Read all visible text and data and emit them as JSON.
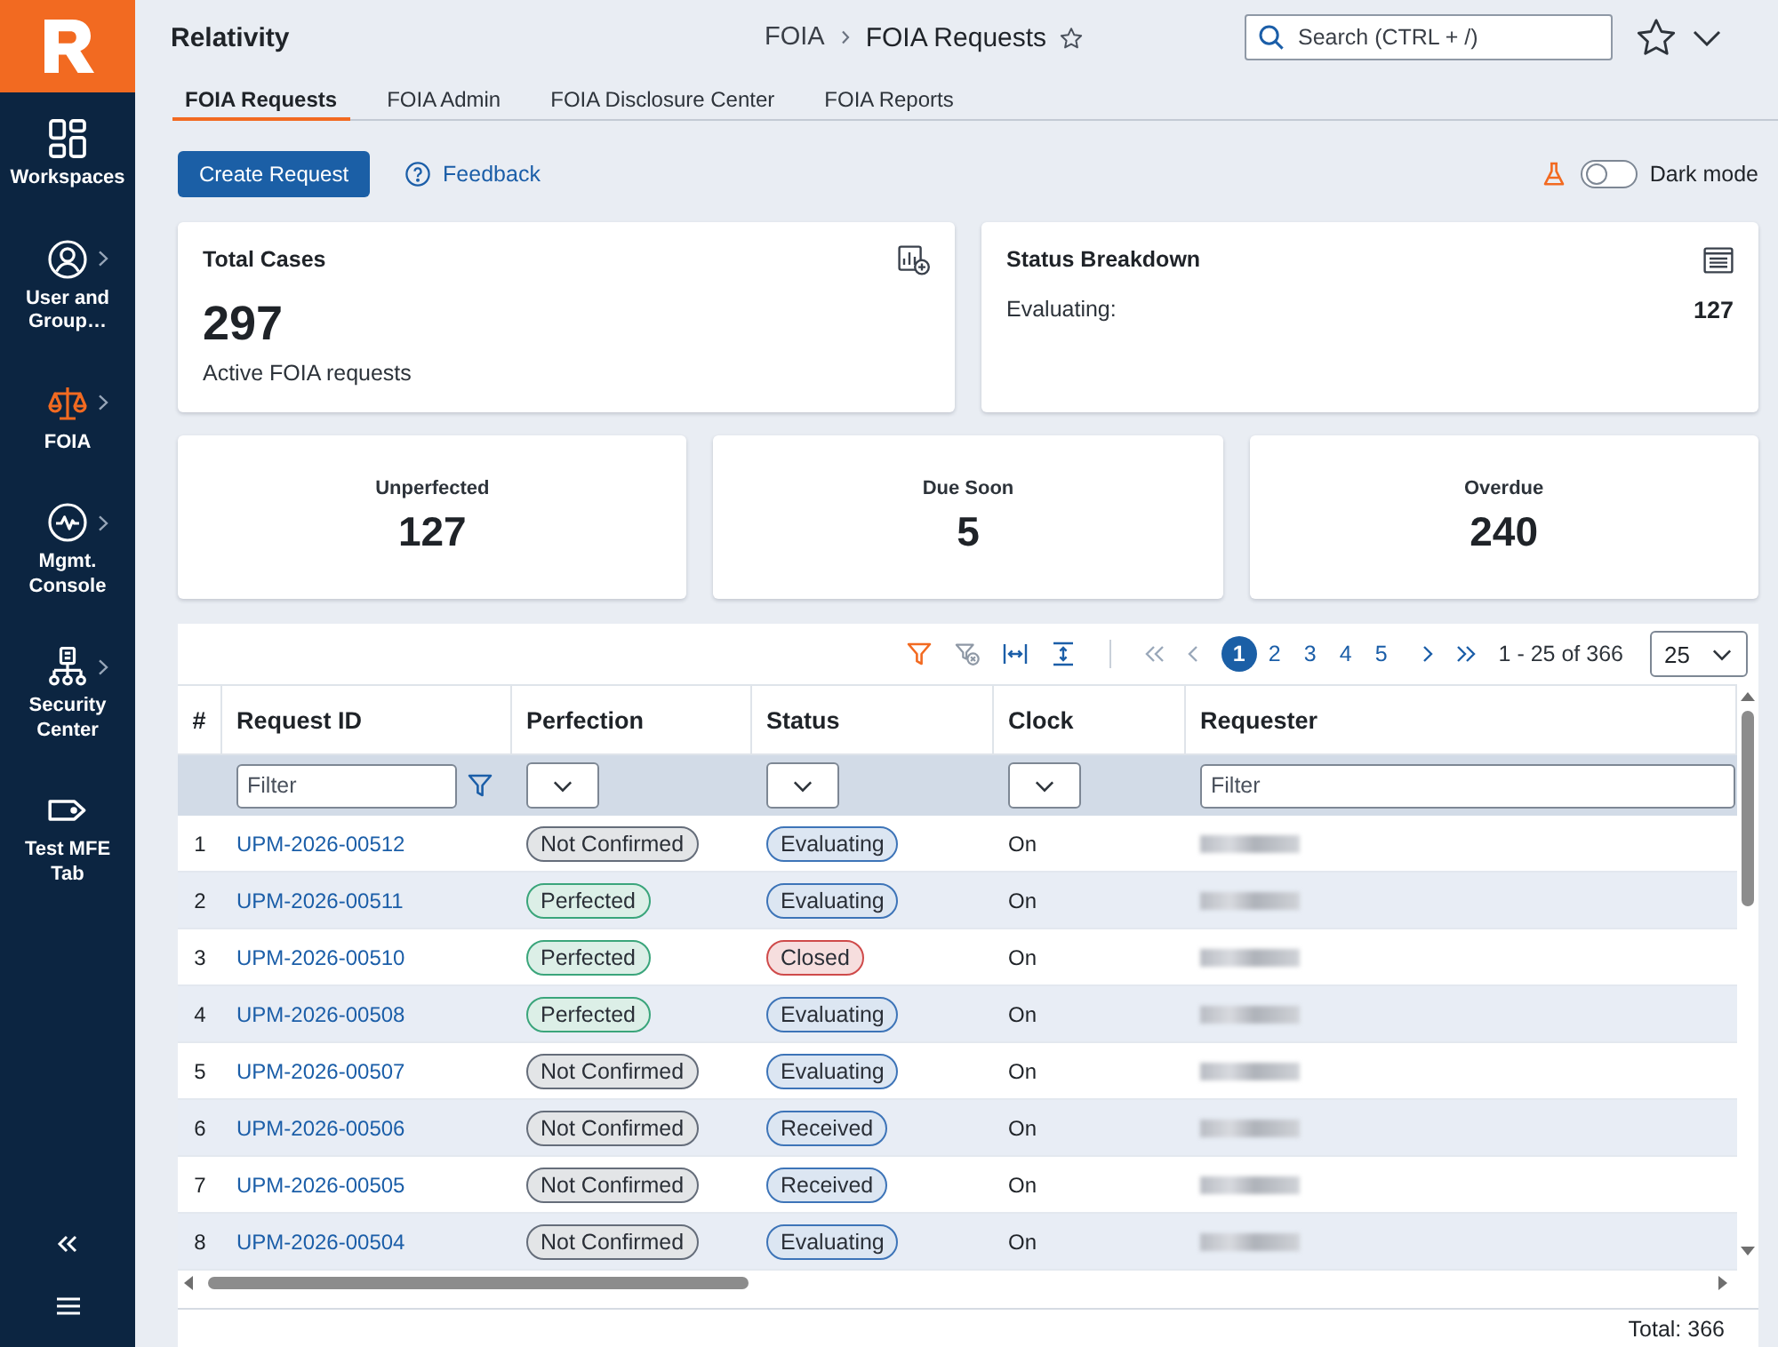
{
  "sidebar": {
    "items": [
      {
        "label": "Workspaces",
        "selected": false,
        "expandable": false
      },
      {
        "label": "User and Group…",
        "selected": false,
        "expandable": true
      },
      {
        "label": "FOIA",
        "selected": true,
        "expandable": true
      },
      {
        "label": "Mgmt. Console",
        "selected": false,
        "expandable": true
      },
      {
        "label": "Security Center",
        "selected": false,
        "expandable": true
      },
      {
        "label": "Test MFE Tab",
        "selected": false,
        "expandable": false
      }
    ]
  },
  "header": {
    "title": "Relativity",
    "breadcrumb": [
      "FOIA",
      "FOIA Requests"
    ],
    "search": {
      "placeholder": "Search (CTRL + /)"
    }
  },
  "tabs": [
    {
      "label": "FOIA Requests",
      "selected": true
    },
    {
      "label": "FOIA Admin",
      "selected": false
    },
    {
      "label": "FOIA Disclosure Center",
      "selected": false
    },
    {
      "label": "FOIA Reports",
      "selected": false
    }
  ],
  "actions": {
    "primary_button": "Create Request",
    "feedback_link": "Feedback",
    "dark_mode": {
      "label": "Dark mode",
      "on": false
    }
  },
  "summary": {
    "total_cases": {
      "title": "Total Cases",
      "value": "297",
      "caption": "Active FOIA requests"
    },
    "status_breakdown": {
      "title": "Status Breakdown",
      "rows": [
        {
          "label": "Evaluating:",
          "value": "127"
        }
      ]
    }
  },
  "stats": [
    {
      "label": "Unperfected",
      "value": "127"
    },
    {
      "label": "Due Soon",
      "value": "5"
    },
    {
      "label": "Overdue",
      "value": "240"
    }
  ],
  "table": {
    "pagination": {
      "first": {
        "disabled": true
      },
      "previous": {
        "disabled": true
      },
      "pages": [
        {
          "label": "1",
          "selected": true
        },
        {
          "label": "2",
          "selected": false
        },
        {
          "label": "3",
          "selected": false
        },
        {
          "label": "4",
          "selected": false
        },
        {
          "label": "5",
          "selected": false
        }
      ],
      "next": {
        "disabled": false
      },
      "last": {
        "disabled": false
      },
      "range": "1 - 25 of 366",
      "page_size": "25"
    },
    "columns": [
      {
        "label": "#"
      },
      {
        "label": "Request ID",
        "filter": {
          "kind": "text",
          "placeholder": "Filter",
          "funnel": true
        }
      },
      {
        "label": "Perfection",
        "filter": {
          "kind": "select"
        }
      },
      {
        "label": "Status",
        "filter": {
          "kind": "select"
        }
      },
      {
        "label": "Clock",
        "filter": {
          "kind": "select"
        }
      },
      {
        "label": "Requester",
        "filter": {
          "kind": "text",
          "placeholder": "Filter",
          "funnel": false
        }
      }
    ],
    "rows": [
      {
        "number": "1",
        "request_id": "UPM-2026-00512",
        "perfection": {
          "label": "Not Confirmed",
          "color": "#656d7a"
        },
        "status": {
          "label": "Evaluating",
          "color": "#3d74b8"
        },
        "clock": "On",
        "requester_redacted": true
      },
      {
        "number": "2",
        "request_id": "UPM-2026-00511",
        "perfection": {
          "label": "Perfected",
          "color": "#3aa57b"
        },
        "status": {
          "label": "Evaluating",
          "color": "#3d74b8"
        },
        "clock": "On",
        "requester_redacted": true
      },
      {
        "number": "3",
        "request_id": "UPM-2026-00510",
        "perfection": {
          "label": "Perfected",
          "color": "#3aa57b"
        },
        "status": {
          "label": "Closed",
          "color": "#cf4a4a"
        },
        "clock": "On",
        "requester_redacted": true
      },
      {
        "number": "4",
        "request_id": "UPM-2026-00508",
        "perfection": {
          "label": "Perfected",
          "color": "#3aa57b"
        },
        "status": {
          "label": "Evaluating",
          "color": "#3d74b8"
        },
        "clock": "On",
        "requester_redacted": true
      },
      {
        "number": "5",
        "request_id": "UPM-2026-00507",
        "perfection": {
          "label": "Not Confirmed",
          "color": "#656d7a"
        },
        "status": {
          "label": "Evaluating",
          "color": "#3d74b8"
        },
        "clock": "On",
        "requester_redacted": true
      },
      {
        "number": "6",
        "request_id": "UPM-2026-00506",
        "perfection": {
          "label": "Not Confirmed",
          "color": "#656d7a"
        },
        "status": {
          "label": "Received",
          "color": "#3d74b8"
        },
        "clock": "On",
        "requester_redacted": true
      },
      {
        "number": "7",
        "request_id": "UPM-2026-00505",
        "perfection": {
          "label": "Not Confirmed",
          "color": "#656d7a"
        },
        "status": {
          "label": "Received",
          "color": "#3d74b8"
        },
        "clock": "On",
        "requester_redacted": true
      },
      {
        "number": "8",
        "request_id": "UPM-2026-00504",
        "perfection": {
          "label": "Not Confirmed",
          "color": "#656d7a"
        },
        "status": {
          "label": "Evaluating",
          "color": "#3d74b8"
        },
        "clock": "On",
        "requester_redacted": true
      }
    ],
    "total": "Total: 366"
  }
}
